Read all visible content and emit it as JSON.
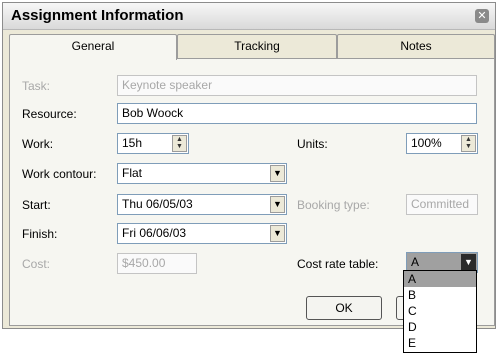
{
  "dialog": {
    "title": "Assignment Information"
  },
  "tabs": [
    {
      "label": "General"
    },
    {
      "label": "Tracking"
    },
    {
      "label": "Notes"
    }
  ],
  "form": {
    "task": {
      "label": "Task:",
      "value": "Keynote speaker"
    },
    "resource": {
      "label": "Resource:",
      "value": "Bob Woock"
    },
    "work": {
      "label": "Work:",
      "value": "15h"
    },
    "units": {
      "label": "Units:",
      "value": "100%"
    },
    "work_contour": {
      "label": "Work contour:",
      "value": "Flat"
    },
    "start": {
      "label": "Start:",
      "value": "Thu 06/05/03"
    },
    "booking_type": {
      "label": "Booking type:",
      "value": "Committed"
    },
    "finish": {
      "label": "Finish:",
      "value": "Fri 06/06/03"
    },
    "cost": {
      "label": "Cost:",
      "value": "$450.00"
    },
    "cost_rate_table": {
      "label": "Cost rate table:",
      "value": "A"
    }
  },
  "buttons": {
    "ok": "OK"
  },
  "cost_rate_options": [
    "A",
    "B",
    "C",
    "D",
    "E"
  ]
}
